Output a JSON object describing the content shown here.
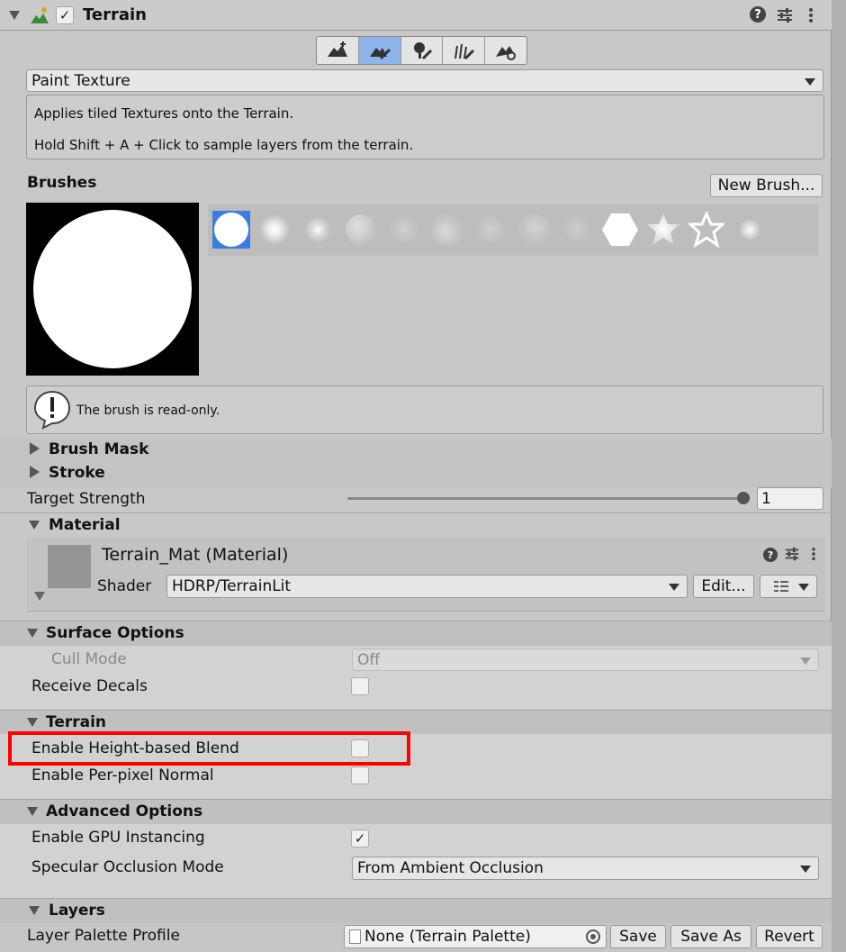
{
  "header": {
    "title": "Terrain",
    "enabled": true
  },
  "toolbar": {
    "tools": [
      {
        "icon": "raise-terrain-icon",
        "active": false
      },
      {
        "icon": "paint-terrain-icon",
        "active": true
      },
      {
        "icon": "paint-trees-icon",
        "active": false
      },
      {
        "icon": "paint-details-icon",
        "active": false
      },
      {
        "icon": "terrain-settings-icon",
        "active": false
      }
    ]
  },
  "mode": {
    "selected": "Paint Texture"
  },
  "info": {
    "line1": "Applies tiled Textures onto the Terrain.",
    "line2": "Hold Shift + A + Click to sample layers from the terrain."
  },
  "brushes": {
    "label": "Brushes",
    "new_brush": "New Brush...",
    "readonly_msg": "The brush is read-only."
  },
  "brush_mask": {
    "label": "Brush Mask"
  },
  "stroke": {
    "label": "Stroke"
  },
  "target_strength": {
    "label": "Target Strength",
    "value": "1",
    "slider_fraction": 1.0
  },
  "material": {
    "section_label": "Material",
    "name": "Terrain_Mat (Material)",
    "shader_label": "Shader",
    "shader_value": "HDRP/TerrainLit",
    "edit_button": "Edit..."
  },
  "surface_options": {
    "label": "Surface Options",
    "cull_mode_label": "Cull Mode",
    "cull_mode_value": "Off",
    "receive_decals_label": "Receive Decals",
    "receive_decals": false
  },
  "terrain_section": {
    "label": "Terrain",
    "height_blend_label": "Enable Height-based Blend",
    "height_blend": false,
    "per_pixel_normal_label": "Enable Per-pixel Normal",
    "per_pixel_normal": false
  },
  "advanced_options": {
    "label": "Advanced Options",
    "gpu_instancing_label": "Enable GPU Instancing",
    "gpu_instancing": true,
    "specular_occlusion_label": "Specular Occlusion Mode",
    "specular_occlusion_value": "From Ambient Occlusion"
  },
  "layers": {
    "label": "Layers",
    "palette_label": "Layer Palette Profile",
    "palette_value": "None (Terrain Palette)",
    "save": "Save",
    "save_as": "Save As",
    "revert": "Revert"
  },
  "colors": {
    "active_tool": "#8fb4ec",
    "selected_brush": "#3a7ee0",
    "highlight": "#ff0000"
  }
}
